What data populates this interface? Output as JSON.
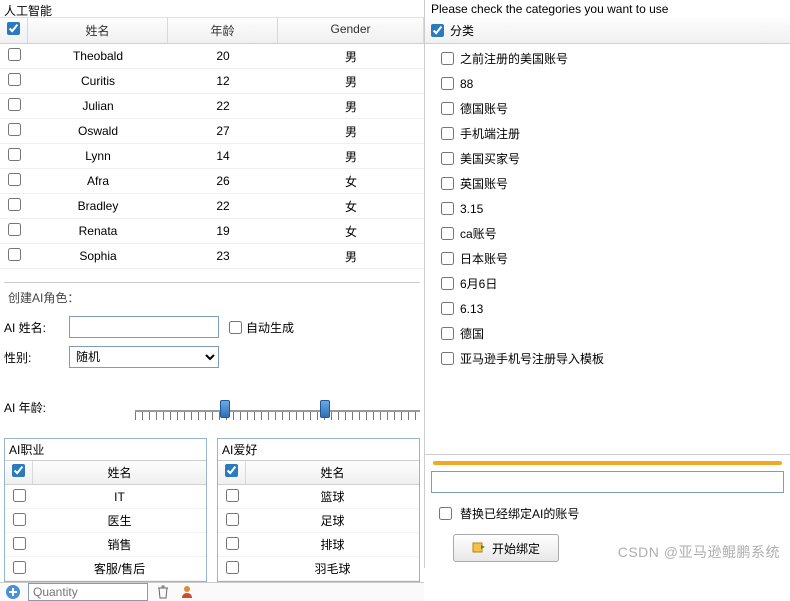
{
  "left": {
    "title": "人工智能",
    "main_grid": {
      "header_checked": true,
      "headers": {
        "name": "姓名",
        "age": "年龄",
        "gender": "Gender"
      },
      "rows": [
        {
          "name": "Theobald",
          "age": "20",
          "gender": "男"
        },
        {
          "name": "Curitis",
          "age": "12",
          "gender": "男"
        },
        {
          "name": "Julian",
          "age": "22",
          "gender": "男"
        },
        {
          "name": "Oswald",
          "age": "27",
          "gender": "男"
        },
        {
          "name": "Lynn",
          "age": "14",
          "gender": "男"
        },
        {
          "name": "Afra",
          "age": "26",
          "gender": "女"
        },
        {
          "name": "Bradley",
          "age": "22",
          "gender": "女"
        },
        {
          "name": "Renata",
          "age": "19",
          "gender": "女"
        },
        {
          "name": "Sophia",
          "age": "23",
          "gender": "男"
        }
      ]
    },
    "create": {
      "section_title": "创建AI角色：",
      "name_label": "AI 姓名:",
      "name_value": "",
      "auto_gen_label": "自动生成",
      "gender_label": "性别:",
      "gender_value": "随机",
      "age_label": "AI 年龄:"
    },
    "job_grid": {
      "title": "AI职业",
      "header_checked": true,
      "header": "姓名",
      "rows": [
        "IT",
        "医生",
        "销售",
        "客服/售后"
      ]
    },
    "hobby_grid": {
      "title": "AI爱好",
      "header_checked": true,
      "header": "姓名",
      "rows": [
        "篮球",
        "足球",
        "排球",
        "羽毛球"
      ]
    },
    "bottom_bar": {
      "quantity_placeholder": "Quantity"
    }
  },
  "right": {
    "title": "Please check the categories you want to use",
    "cat_header": {
      "checked": true,
      "label": "分类"
    },
    "categories": [
      "之前注册的美国账号",
      "88",
      "德国账号",
      "手机端注册",
      "美国买家号",
      "英国账号",
      "3.15",
      "ca账号",
      "日本账号",
      "6月6日",
      "6.13",
      "德国",
      "亚马逊手机号注册导入模板"
    ],
    "replace_label": "替换已经绑定AI的账号",
    "bind_button": "开始绑定"
  },
  "watermark": "CSDN @亚马逊鲲鹏系统"
}
